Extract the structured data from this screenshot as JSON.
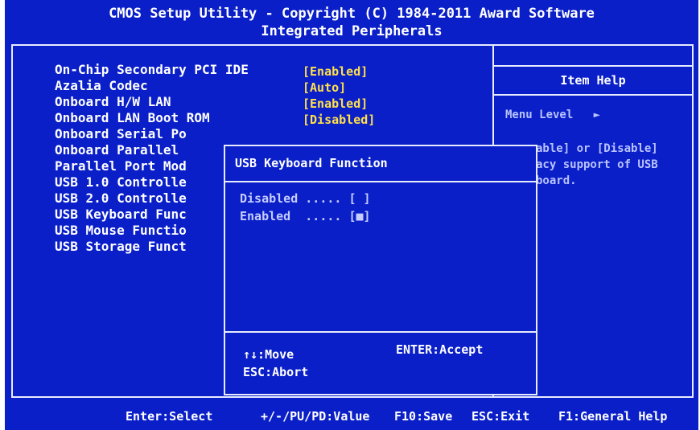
{
  "title": {
    "line1": "CMOS Setup Utility - Copyright (C) 1984-2011 Award Software",
    "line2": "Integrated Peripherals"
  },
  "menu": {
    "items": [
      {
        "label": "On-Chip Secondary PCI IDE",
        "value": "[Enabled]"
      },
      {
        "label": "Azalia Codec",
        "value": "[Auto]"
      },
      {
        "label": "Onboard H/W LAN",
        "value": "[Enabled]"
      },
      {
        "label": "Onboard LAN Boot ROM",
        "value": "[Disabled]"
      },
      {
        "label": "Onboard Serial Po",
        "value": ""
      },
      {
        "label": "Onboard Parallel",
        "value": ""
      },
      {
        "label": "Parallel Port Mod",
        "value": ""
      },
      {
        "label": "USB 1.0 Controlle",
        "value": ""
      },
      {
        "label": "USB 2.0 Controlle",
        "value": ""
      },
      {
        "label": "USB Keyboard Func",
        "value": ""
      },
      {
        "label": "USB Mouse Functio",
        "value": ""
      },
      {
        "label": "USB Storage Funct",
        "value": ""
      }
    ]
  },
  "help": {
    "header": "Item Help",
    "menu_level": "Menu Level",
    "menu_level_arrow": "►",
    "text_lines": [
      "able] or [Disable]",
      "acy support of USB",
      "board."
    ]
  },
  "dialog": {
    "title": "USB Keyboard Function",
    "options": [
      {
        "label": "Disabled ..... [ ]"
      },
      {
        "label": "Enabled  ..... [■]"
      }
    ],
    "move_hint": "↑↓:Move",
    "accept_hint": "ENTER:Accept",
    "abort_hint": "ESC:Abort"
  },
  "footer": {
    "select": "Enter:Select",
    "value": "+/-/PU/PD:Value",
    "save": "F10:Save",
    "exit": "ESC:Exit",
    "help": "F1:General Help"
  }
}
